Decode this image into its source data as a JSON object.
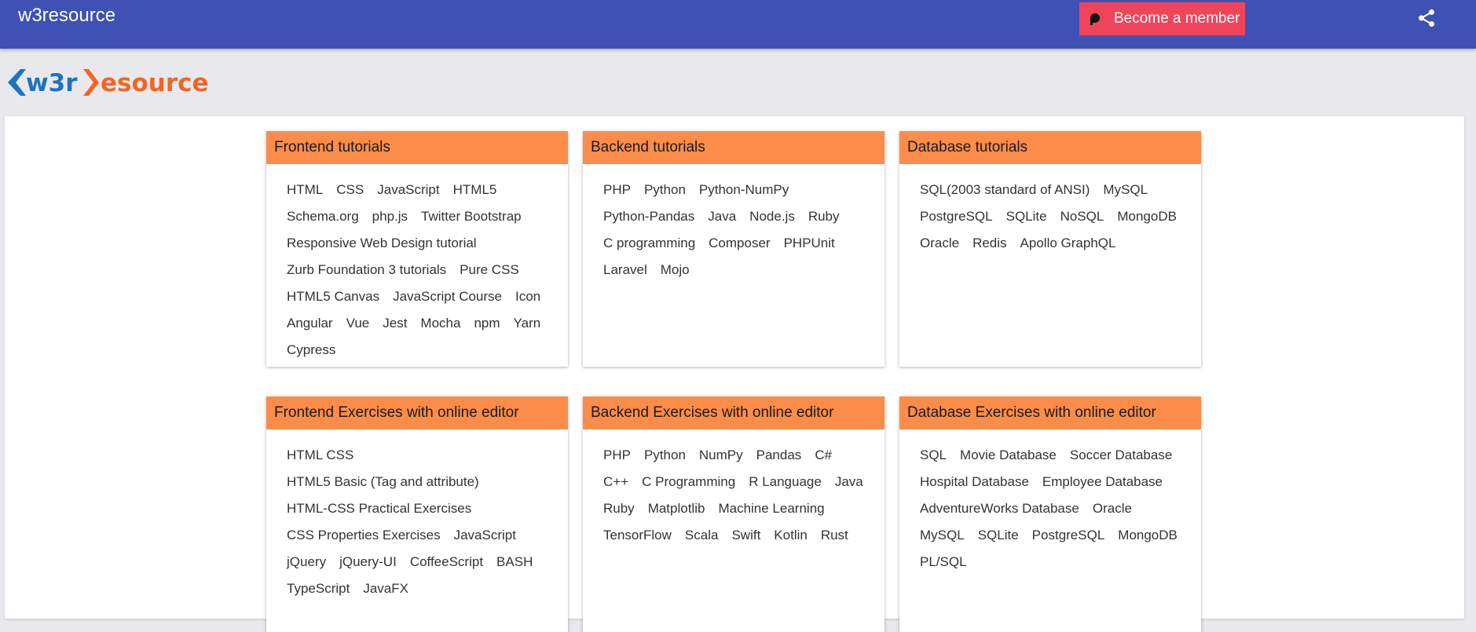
{
  "header": {
    "site_title": "w3resource",
    "member_button_label": "Become a member"
  },
  "logo": {
    "bracket_text": "w3r",
    "rest_text": "esource"
  },
  "colors": {
    "topbar": "#3f51b5",
    "member_button": "#f0445a",
    "card_header": "#fb8c4a",
    "logo_blue": "#1e73be",
    "logo_orange": "#f26522"
  },
  "icons": {
    "member": "patreon-icon",
    "share": "share-icon"
  },
  "cards": [
    {
      "title": "Frontend tutorials",
      "rows": [
        [
          "HTML",
          "CSS",
          "JavaScript",
          "HTML5"
        ],
        [
          "Schema.org",
          "php.js",
          "Twitter Bootstrap"
        ],
        [
          "Responsive Web Design tutorial"
        ],
        [
          "Zurb Foundation 3 tutorials",
          "Pure CSS"
        ],
        [
          "HTML5 Canvas",
          "JavaScript Course",
          "Icon"
        ],
        [
          "Angular",
          "Vue",
          "Jest",
          "Mocha",
          "npm",
          "Yarn"
        ],
        [
          "Cypress"
        ]
      ]
    },
    {
      "title": "Backend tutorials",
      "rows": [
        [
          "PHP",
          "Python",
          "Python-NumPy"
        ],
        [
          "Python-Pandas",
          "Java",
          "Node.js",
          "Ruby"
        ],
        [
          "C programming",
          "Composer",
          "PHPUnit"
        ],
        [
          "Laravel",
          "Mojo"
        ]
      ]
    },
    {
      "title": "Database tutorials",
      "rows": [
        [
          "SQL(2003 standard of ANSI)",
          "MySQL"
        ],
        [
          "PostgreSQL",
          "SQLite",
          "NoSQL",
          "MongoDB"
        ],
        [
          "Oracle",
          "Redis",
          "Apollo GraphQL"
        ]
      ]
    },
    {
      "title": "Frontend Exercises with online editor",
      "rows": [
        [
          "HTML CSS"
        ],
        [
          "HTML5 Basic (Tag and attribute)"
        ],
        [
          "HTML-CSS Practical Exercises"
        ],
        [
          "CSS Properties Exercises",
          "JavaScript"
        ],
        [
          "jQuery",
          "jQuery-UI",
          "CoffeeScript",
          "BASH"
        ],
        [
          "TypeScript",
          "JavaFX"
        ]
      ]
    },
    {
      "title": "Backend Exercises with online editor",
      "rows": [
        [
          "PHP",
          "Python",
          "NumPy",
          "Pandas",
          "C#"
        ],
        [
          "C++",
          "C Programming",
          "R Language",
          "Java"
        ],
        [
          "Ruby",
          "Matplotlib",
          "Machine Learning"
        ],
        [
          "TensorFlow",
          "Scala",
          "Swift",
          "Kotlin",
          "Rust"
        ]
      ]
    },
    {
      "title": "Database Exercises with online editor",
      "rows": [
        [
          "SQL",
          "Movie Database",
          "Soccer Database"
        ],
        [
          "Hospital Database",
          "Employee Database"
        ],
        [
          "AdventureWorks Database",
          "Oracle"
        ],
        [
          "MySQL",
          "SQLite",
          "PostgreSQL",
          "MongoDB"
        ],
        [
          "PL/SQL"
        ]
      ]
    }
  ]
}
